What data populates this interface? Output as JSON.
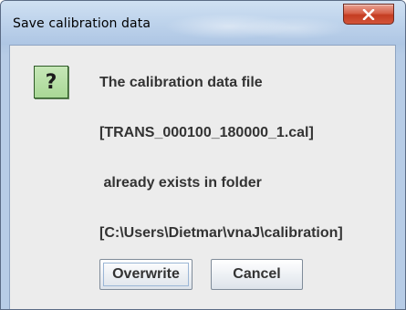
{
  "window": {
    "title": "Save calibration data"
  },
  "icons": {
    "question": "?"
  },
  "message": {
    "line1": "The calibration data file",
    "line2": "[TRANS_000100_180000_1.cal]",
    "line3": " already exists in folder",
    "line4": "[C:\\Users\\Dietmar\\vnaJ\\calibration]"
  },
  "buttons": {
    "overwrite": "Overwrite",
    "cancel": "Cancel"
  },
  "colors": {
    "close_button": "#c53d22",
    "question_icon_bg": "#a9d896",
    "dialog_bg": "#ececec",
    "frame": "#bcd1ea"
  }
}
